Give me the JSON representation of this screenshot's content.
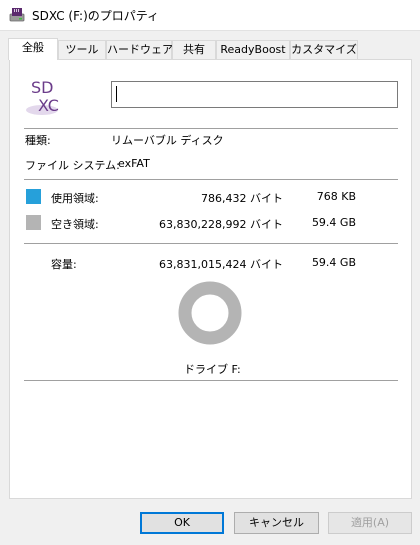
{
  "window": {
    "title": "SDXC (F:)のプロパティ",
    "icon": "sd-card-drive-icon"
  },
  "tabs": [
    {
      "label": "全般",
      "active": true
    },
    {
      "label": "ツール"
    },
    {
      "label": "ハードウェア"
    },
    {
      "label": "共有"
    },
    {
      "label": "ReadyBoost"
    },
    {
      "label": "カスタマイズ"
    }
  ],
  "general": {
    "logo_text_top": "SD",
    "logo_text_bottom": "XC",
    "name_input_value": "",
    "type_label": "種類:",
    "type_value": "リムーバブル ディスク",
    "fs_label": "ファイル システム:",
    "fs_value": "exFAT",
    "used": {
      "label": "使用領域:",
      "bytes": "786,432 バイト",
      "size": "768 KB",
      "color": "#26a0da"
    },
    "free": {
      "label": "空き領域:",
      "bytes": "63,830,228,992 バイト",
      "size": "59.4 GB",
      "color": "#b4b4b4"
    },
    "capacity": {
      "label": "容量:",
      "bytes": "63,831,015,424 バイト",
      "size": "59.4 GB"
    },
    "usage_fraction": 1.23e-05,
    "drive_label": "ドライブ F:"
  },
  "buttons": {
    "ok": "OK",
    "cancel": "キャンセル",
    "apply": "適用(A)"
  }
}
